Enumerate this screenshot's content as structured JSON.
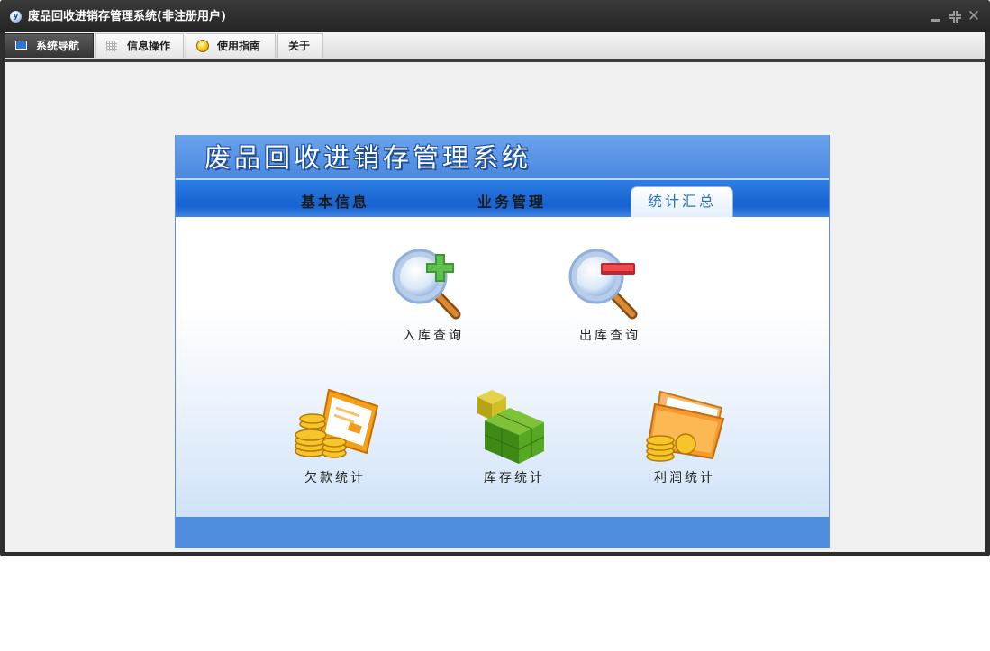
{
  "window": {
    "title": "废品回收进销存管理系统(非注册用户)",
    "logo_text": "y"
  },
  "tabs": [
    {
      "label": "系统导航",
      "icon": "monitor-icon",
      "active": true
    },
    {
      "label": "信息操作",
      "icon": "grid-icon",
      "active": false
    },
    {
      "label": "使用指南",
      "icon": "help-icon",
      "active": false
    },
    {
      "label": "关于",
      "icon": "",
      "active": false
    }
  ],
  "panel": {
    "title": "废品回收进销存管理系统",
    "nav": [
      {
        "label": "基本信息",
        "active": false
      },
      {
        "label": "业务管理",
        "active": false
      },
      {
        "label": "统计汇总",
        "active": true
      }
    ],
    "functions": [
      {
        "label": "入库查询",
        "icon": "magnifier-plus-icon"
      },
      {
        "label": "出库查询",
        "icon": "magnifier-minus-icon"
      },
      {
        "label": "欠款统计",
        "icon": "coins-card-icon"
      },
      {
        "label": "库存统计",
        "icon": "green-cubes-icon"
      },
      {
        "label": "利润统计",
        "icon": "folder-coins-icon"
      }
    ]
  },
  "colors": {
    "title_bar": "#2e2e2e",
    "panel_header": "#4a88e0",
    "nav_band": "#1562d0",
    "panel_footer": "#4f8ddf",
    "content_bg": "#f0f0f0"
  }
}
